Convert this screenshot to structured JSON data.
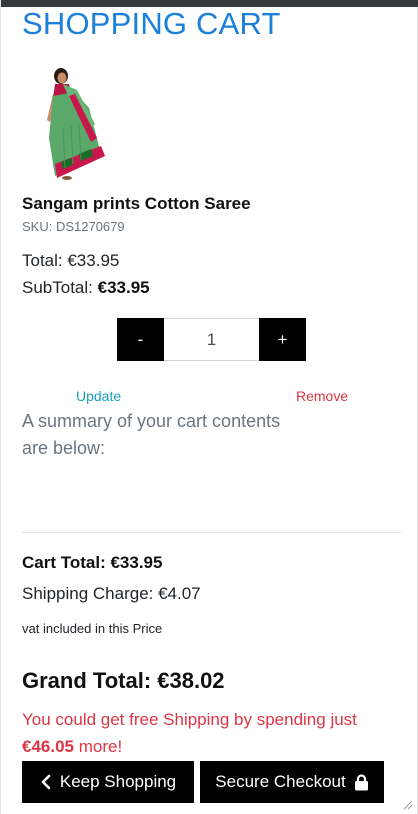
{
  "page": {
    "title": "SHOPPING CART"
  },
  "item": {
    "image_icon": "saree-product-photo",
    "name": "Sangam prints Cotton Saree",
    "sku": "SKU: DS1270679",
    "total": "Total: €33.95",
    "subtotal_label": "SubTotal:",
    "subtotal_value": "€33.95",
    "quantity": "1",
    "decrease_label": "-",
    "increase_label": "+",
    "update_label": "Update",
    "remove_label": "Remove"
  },
  "summary": {
    "text": "A summary of your cart contents are below:",
    "cart_total": "Cart Total: €33.95",
    "shipping_charge": "Shipping Charge: €4.07",
    "vat_note": "vat included in this Price",
    "grand_total": "Grand Total: €38.02",
    "free_shipping_prefix": "You could get free Shipping by spending just",
    "free_shipping_amount": "€46.05",
    "free_shipping_suffix": "more!"
  },
  "actions": {
    "keep_shopping_label": "Keep Shopping",
    "keep_shopping_icon": "chevron-left-icon",
    "checkout_label": "Secure Checkout",
    "checkout_icon": "lock-icon"
  },
  "colors": {
    "title": "#1a80d9",
    "update_link": "#17a2b8",
    "remove_link": "#dc3545",
    "free_shipping": "#dc3545",
    "buttons": "#000000"
  }
}
